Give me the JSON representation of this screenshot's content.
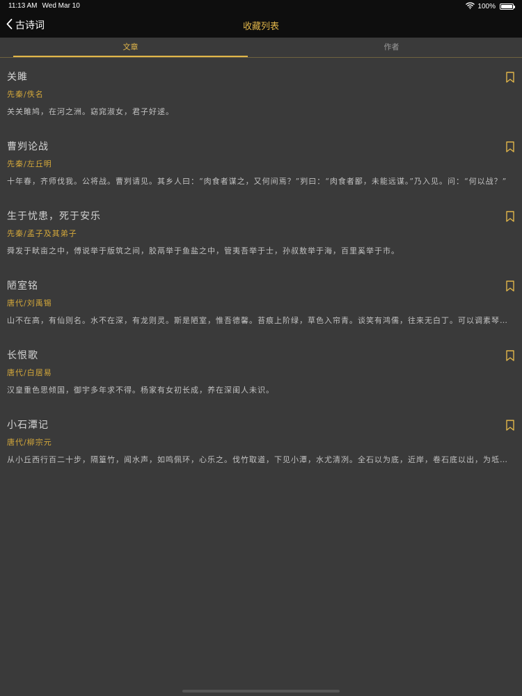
{
  "status_bar": {
    "time": "11:13 AM",
    "date": "Wed Mar 10",
    "battery_text": "100%",
    "battery_level": 1.0
  },
  "nav": {
    "back_label": "古诗词",
    "title": "收藏列表"
  },
  "tabs": [
    {
      "label": "文章",
      "active": true
    },
    {
      "label": "作者",
      "active": false
    }
  ],
  "colors": {
    "accent": "#e1b64a",
    "background": "#3a3a3a",
    "bar": "#0e0e0e"
  },
  "items": [
    {
      "title": "关雎",
      "author": "先秦/佚名",
      "excerpt": "关关雎鸠，在河之洲。窈窕淑女，君子好逑。",
      "bookmark_icon": "bookmark-outline"
    },
    {
      "title": "曹刿论战",
      "author": "先秦/左丘明",
      "excerpt": "十年春，齐师伐我。公将战。曹刿请见。其乡人曰：“肉食者谋之，又何间焉？”刿曰：“肉食者鄙，未能远谋。”乃入见。问：“何以战？”",
      "bookmark_icon": "bookmark-outline"
    },
    {
      "title": "生于忧患，死于安乐",
      "author": "先秦/孟子及其弟子",
      "excerpt": "舜发于畎亩之中，傅说举于版筑之间，胶鬲举于鱼盐之中，管夷吾举于士，孙叔敖举于海，百里奚举于市。",
      "bookmark_icon": "bookmark-outline"
    },
    {
      "title": "陋室铭",
      "author": "唐代/刘禹锡",
      "excerpt": "山不在高，有仙则名。水不在深，有龙则灵。斯是陋室，惟吾德馨。苔痕上阶绿，草色入帘青。谈笑有鸿儒，往来无白丁。可以调素琴，阅金经。",
      "bookmark_icon": "bookmark-outline"
    },
    {
      "title": "长恨歌",
      "author": "唐代/白居易",
      "excerpt": "汉皇重色思倾国，御宇多年求不得。杨家有女初长成，养在深闺人未识。",
      "bookmark_icon": "bookmark-outline"
    },
    {
      "title": "小石潭记",
      "author": "唐代/柳宗元",
      "excerpt": "从小丘西行百二十步，隔篁竹，闻水声，如鸣佩环，心乐之。伐竹取道，下见小潭，水尤清冽。全石以为底，近岸，卷石底以出，为坻，为屿，为嵁，为岩。",
      "bookmark_icon": "bookmark-outline"
    }
  ]
}
